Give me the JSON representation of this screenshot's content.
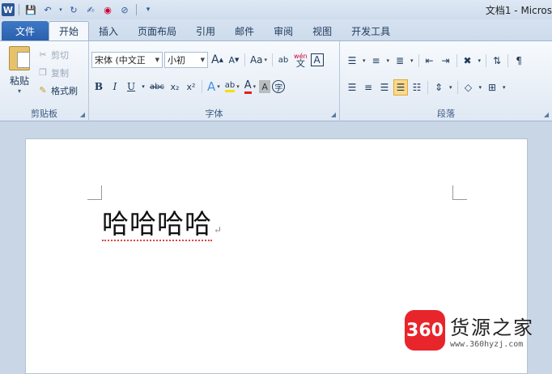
{
  "window": {
    "title": "文档1 - Micros"
  },
  "qat": {
    "logo": "W",
    "save_icon": "save-icon",
    "undo_icon": "undo-icon",
    "redo_icon": "redo-icon"
  },
  "tabs": [
    {
      "label": "文件"
    },
    {
      "label": "开始"
    },
    {
      "label": "插入"
    },
    {
      "label": "页面布局"
    },
    {
      "label": "引用"
    },
    {
      "label": "邮件"
    },
    {
      "label": "审阅"
    },
    {
      "label": "视图"
    },
    {
      "label": "开发工具"
    }
  ],
  "clipboard": {
    "paste": "粘贴",
    "cut": "剪切",
    "copy": "复制",
    "format_painter": "格式刷",
    "group_label": "剪贴板"
  },
  "font": {
    "font_name": "宋体 (中文正",
    "font_size": "小初",
    "grow": "A",
    "shrink": "A",
    "case": "Aa",
    "clear": "ab",
    "pinyin": "wén",
    "border_char": "A",
    "bold": "B",
    "italic": "I",
    "underline": "U",
    "strike": "abc",
    "subscript": "x₂",
    "superscript": "x²",
    "effects": "A",
    "highlight": "ab",
    "font_color": "A",
    "shading": "A",
    "enclose": "字",
    "group_label": "字体"
  },
  "paragraph": {
    "group_label": "段落"
  },
  "document": {
    "text": "哈哈哈哈",
    "para_mark": "↵"
  },
  "watermark": {
    "badge": "360",
    "name": "货源之家",
    "url": "www.360hyzj.com"
  },
  "colors": {
    "file_tab": "#2a5fae",
    "accent_red": "#e8252b"
  }
}
